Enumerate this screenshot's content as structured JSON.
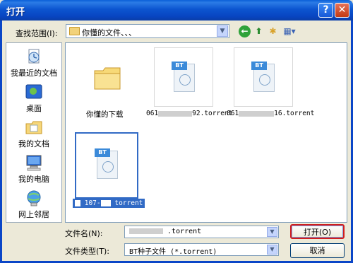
{
  "window": {
    "title": "打开"
  },
  "lookin": {
    "label": "查找范围(I):",
    "value": "你懂的文件、、、"
  },
  "places": [
    {
      "label": "我最近的文档",
      "icon": "recent-documents-icon"
    },
    {
      "label": "桌面",
      "icon": "desktop-icon"
    },
    {
      "label": "我的文档",
      "icon": "my-documents-icon"
    },
    {
      "label": "我的电脑",
      "icon": "my-computer-icon"
    },
    {
      "label": "网上邻居",
      "icon": "network-places-icon"
    }
  ],
  "files": [
    {
      "name": "你懂的下载",
      "type": "folder"
    },
    {
      "prefix": "061",
      "suffix": "92.torrent",
      "type": "torrent"
    },
    {
      "prefix": "061",
      "suffix": "16.torrent",
      "type": "torrent"
    },
    {
      "prefix": "107-",
      "suffix": "torrent",
      "type": "torrent",
      "selected": true
    }
  ],
  "bt_tag": "BT",
  "filename": {
    "label": "文件名(N):",
    "value": ".torrent"
  },
  "filetype": {
    "label": "文件类型(T):",
    "value": "BT种子文件 (*.torrent)"
  },
  "buttons": {
    "open": "打开(O)",
    "cancel": "取消"
  },
  "colors": {
    "titlebar": "#0a55d0",
    "selection": "#316ac5",
    "highlight": "#d11e1e"
  }
}
